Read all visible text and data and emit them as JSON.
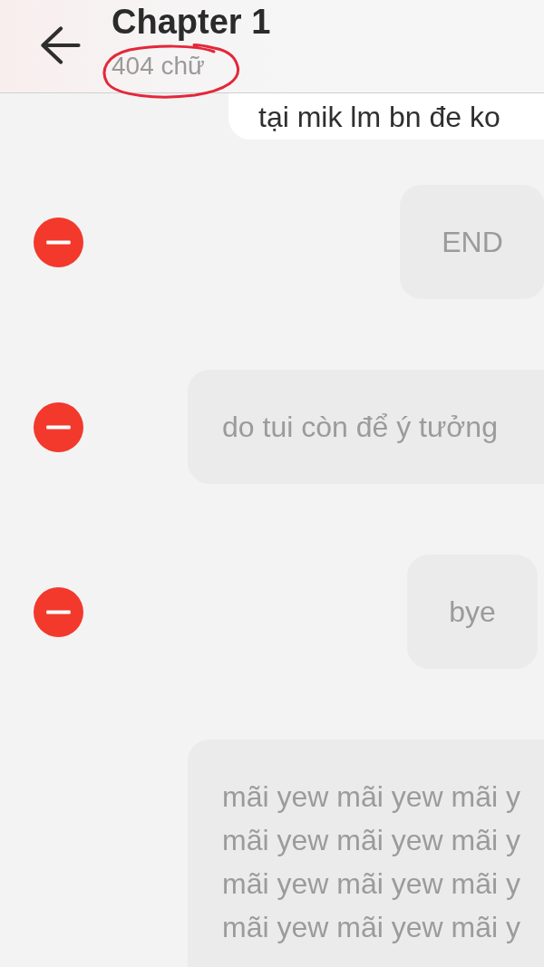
{
  "header": {
    "title": "Chapter 1",
    "word_count": "404 chữ"
  },
  "messages": [
    {
      "text": "tại mik lm bn đe ko",
      "highlighted": true,
      "show_remove": false,
      "overflows_right": true
    },
    {
      "text": "END",
      "highlighted": false,
      "show_remove": true,
      "overflows_right": false
    },
    {
      "text": "do tui còn để ý tưởng",
      "highlighted": false,
      "show_remove": true,
      "overflows_right": true
    },
    {
      "text": "bye",
      "highlighted": false,
      "show_remove": true,
      "overflows_right": false
    },
    {
      "text": "mãi yew mãi yew mãi y\nmãi yew mãi yew mãi y\nmãi yew mãi yew mãi y\nmãi yew mãi yew mãi y",
      "highlighted": false,
      "show_remove": false,
      "overflows_right": true
    }
  ]
}
